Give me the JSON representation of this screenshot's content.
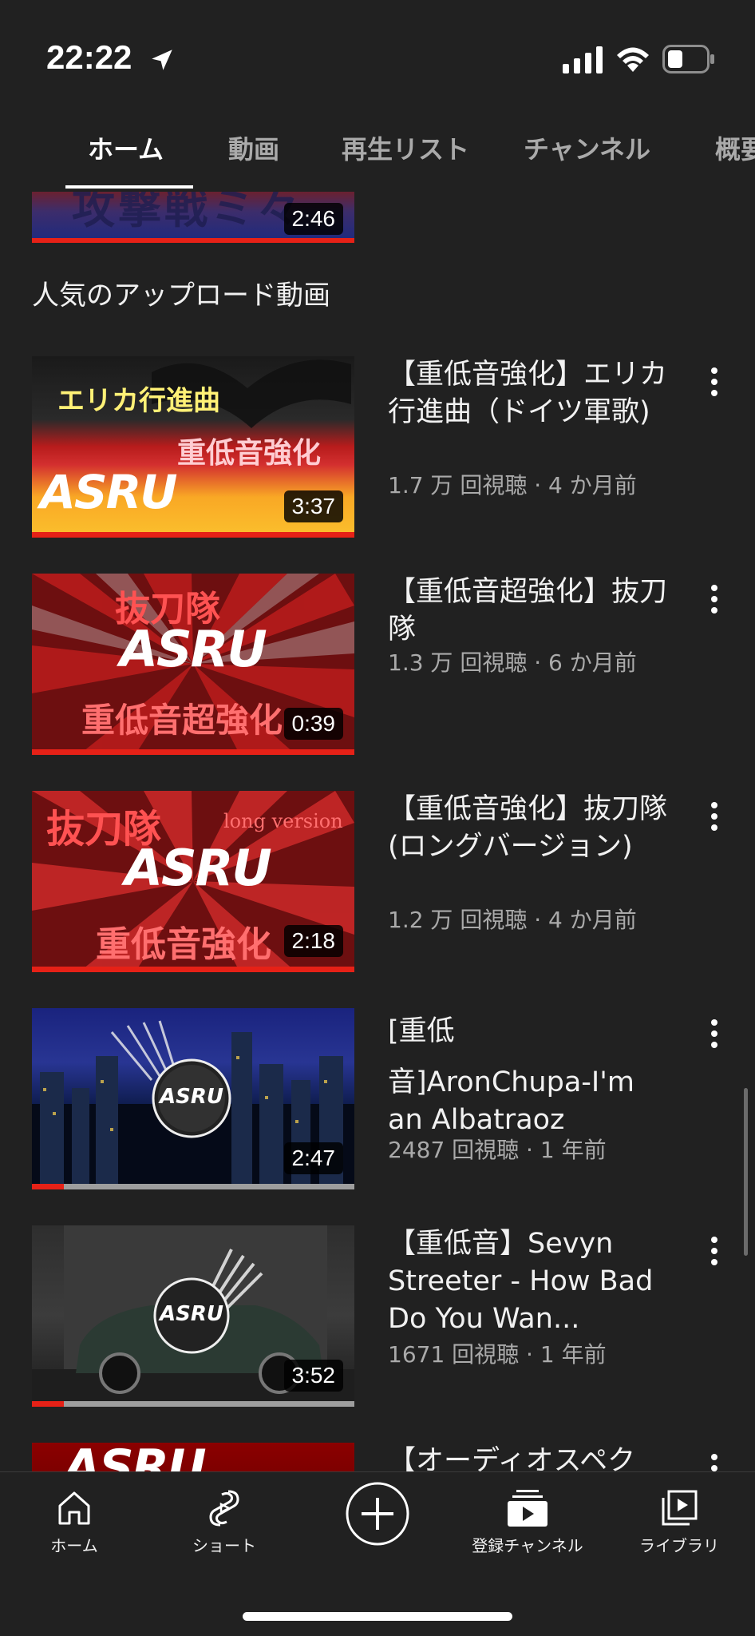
{
  "status_bar": {
    "time": "22:22"
  },
  "tabs": [
    {
      "label": "ホーム",
      "active": true
    },
    {
      "label": "動画"
    },
    {
      "label": "再生リスト"
    },
    {
      "label": "チャンネル"
    },
    {
      "label": "概要"
    }
  ],
  "top_video": {
    "duration": "2:46",
    "thumb_text": "攻撃戦ミ々"
  },
  "section_title": "人気のアップロード動画",
  "videos": [
    {
      "title": "【重低音強化】エリカ行進曲（ドイツ軍歌)",
      "meta": "1.7 万 回視聴 · 4 か月前",
      "duration": "3:37",
      "thumb_text_top": "エリカ行進曲",
      "thumb_text_bottom": "重低音強化",
      "logo": "ASRU",
      "watched": 1.0
    },
    {
      "title": "【重低音超強化】抜刀隊",
      "meta": "1.3 万 回視聴 · 6 か月前",
      "duration": "0:39",
      "thumb_text_top": "抜刀隊",
      "thumb_text_bottom": "重低音超強化",
      "logo": "ASRU",
      "watched": 1.0
    },
    {
      "title": "【重低音強化】抜刀隊(ロングバージョン)",
      "meta": "1.2 万 回視聴 · 4 か月前",
      "duration": "2:18",
      "thumb_text_top": "抜刀隊",
      "thumb_text_side": "long version",
      "thumb_text_bottom": "重低音強化",
      "logo": "ASRU",
      "watched": 1.0
    },
    {
      "title_line1": "[重低",
      "title_line2": "音]AronChupa-I'm an Albatraoz",
      "meta": "2487 回視聴 · 1 年前",
      "duration": "2:47",
      "logo": "ASRU",
      "watched": 0.1
    },
    {
      "title": "【重低音】Sevyn Streeter - How Bad Do You Wan...",
      "meta": "1671 回視聴 · 1 年前",
      "duration": "3:52",
      "logo": "ASRU",
      "watched": 0.1
    },
    {
      "title": "【オーディオスペク",
      "logo": "ASRU"
    }
  ],
  "bottom_nav": [
    {
      "label": "ホーム",
      "icon": "home-icon"
    },
    {
      "label": "ショート",
      "icon": "shorts-icon"
    },
    {
      "label": "",
      "icon": "create-icon"
    },
    {
      "label": "登録チャンネル",
      "icon": "subscriptions-icon"
    },
    {
      "label": "ライブラリ",
      "icon": "library-icon"
    }
  ],
  "colors": {
    "background": "#212121",
    "accent": "#e62117",
    "text": "#f1f1f1",
    "secondary": "#aaaaaa"
  }
}
